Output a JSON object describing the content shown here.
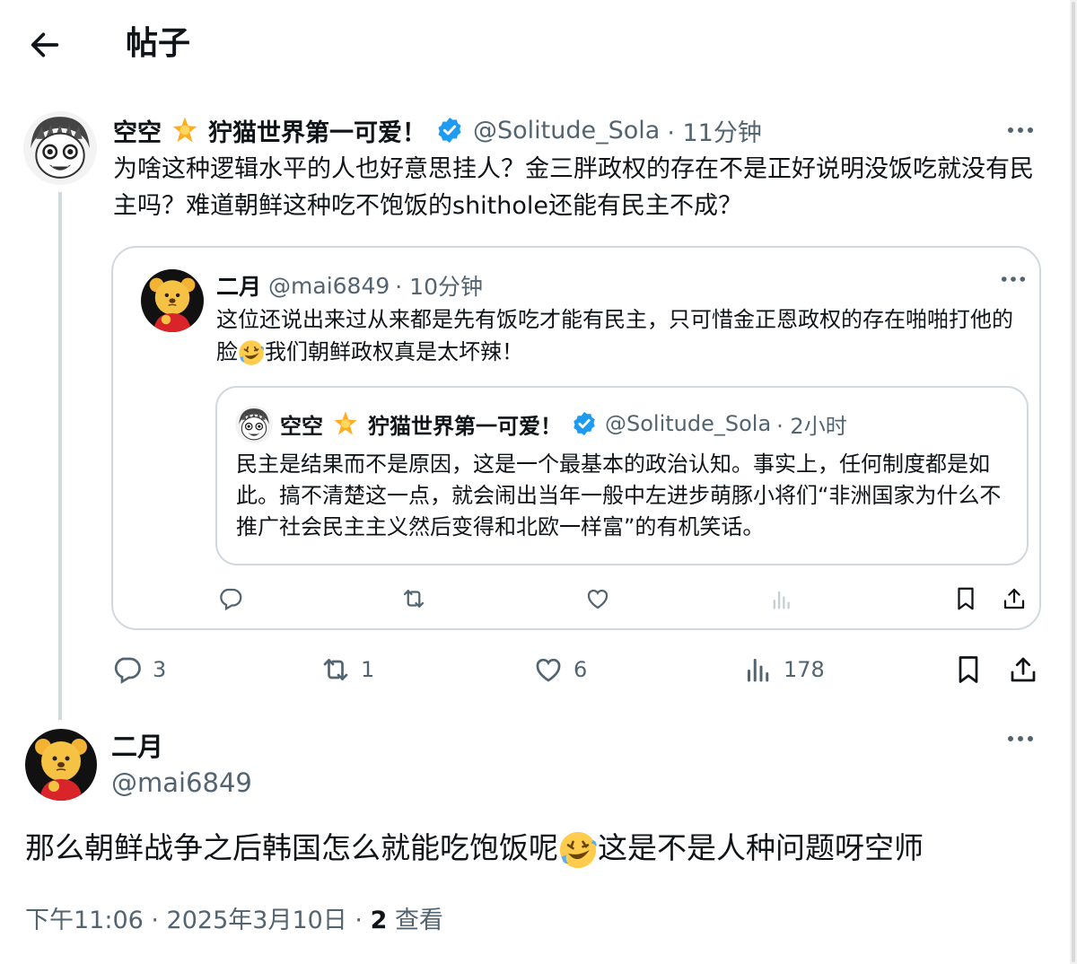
{
  "header": {
    "title": "帖子",
    "back_icon": "arrow-left-icon"
  },
  "post": {
    "display_name": "空空",
    "name_emoji": "🌟",
    "name_suffix": "狞猫世界第一可爱！",
    "verified": true,
    "handle": "@Solitude_Sola",
    "time": "· 11分钟",
    "text": "为啥这种逻辑水平的人也好意思挂人？金三胖政权的存在不是正好说明没饭吃就没有民主吗？难道朝鲜这种吃不饱饭的shithole还能有民主不成？",
    "stats": {
      "replies": "3",
      "reposts": "1",
      "likes": "6",
      "views": "178"
    },
    "quoted": {
      "display_name": "二月",
      "handle": "@mai6849",
      "time": "· 10分钟",
      "text_before_emoji": "这位还说出来过从来都是先有饭吃才能有民主，只可惜金正恩政权的存在啪啪打他的脸",
      "emoji": "🤣",
      "text_after_emoji": "我们朝鲜政权真是太坏辣！",
      "inner": {
        "display_name": "空空",
        "name_emoji": "🌟",
        "name_suffix": "狞猫世界第一可爱！",
        "handle": "@Solitude_Sola",
        "time": "· 2小时",
        "text": "民主是结果而不是原因，这是一个最基本的政治认知。事实上，任何制度都是如此。搞不清楚这一点，就会闹出当年一般中左进步萌豚小将们“非洲国家为什么不推广社会民主主义然后变得和北欧一样富”的有机笑话。"
      }
    }
  },
  "reply": {
    "display_name": "二月",
    "handle": "@mai6849",
    "text_before_emoji": "那么朝鲜战争之后韩国怎么就能吃饱饭呢",
    "emoji": "🤣",
    "text_after_emoji": "这是不是人种问题呀空师",
    "meta_prefix": "下午11:06 · 2025年3月10日 · ",
    "views_count": "2",
    "views_label": " 查看"
  },
  "colors": {
    "text": "#0f1419",
    "secondary": "#536471",
    "border": "#cfd9de",
    "verified": "#1d9bf0"
  }
}
